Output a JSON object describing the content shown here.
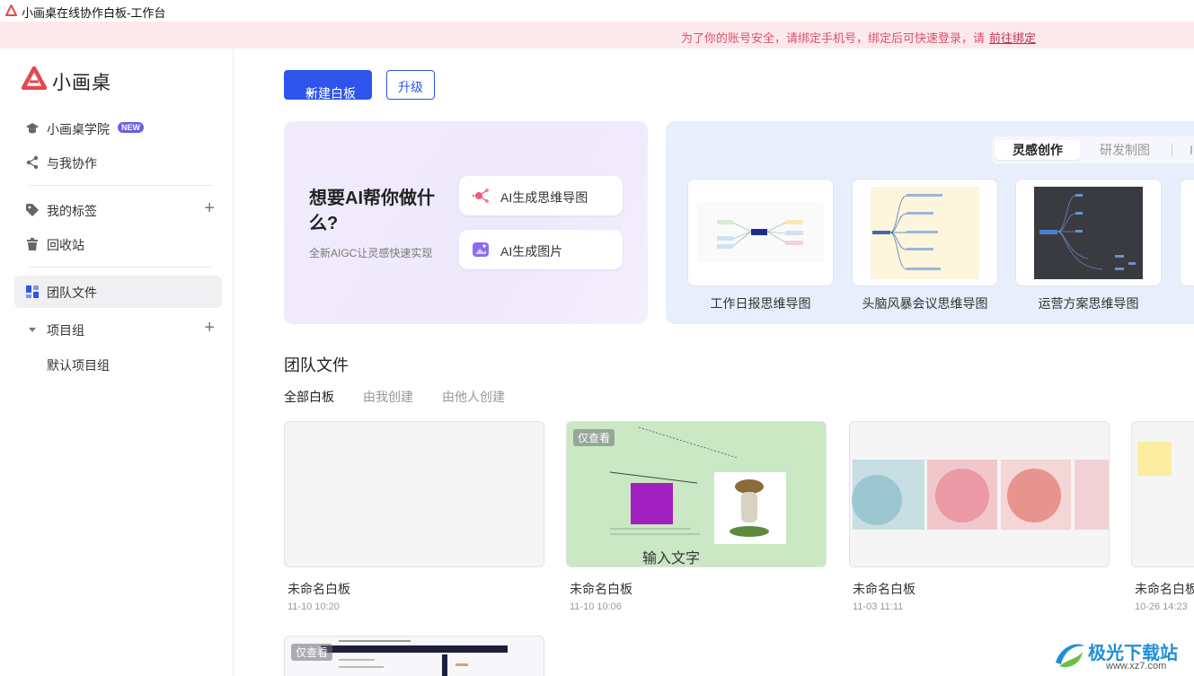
{
  "window": {
    "title": "小画桌在线协作白板-工作台"
  },
  "banner": {
    "message": "为了你的账号安全，请绑定手机号，绑定后可快速登录，请",
    "link": "前往绑定"
  },
  "brand": {
    "name": "小画桌",
    "color": "#e5484d"
  },
  "sidebar": {
    "academy": {
      "label": "小画桌学院",
      "badge": "NEW"
    },
    "collab": {
      "label": "与我协作"
    },
    "tags": {
      "label": "我的标签"
    },
    "trash": {
      "label": "回收站"
    },
    "team_files": {
      "label": "团队文件"
    },
    "project_group": {
      "label": "项目组"
    },
    "default_group": {
      "label": "默认项目组"
    }
  },
  "toolbar": {
    "new_board": "新建白板",
    "upgrade": "升级"
  },
  "ai_card": {
    "headline": "想要AI帮你做什么?",
    "subtitle": "全新AIGC让灵感快速实现",
    "mindmap_button": "AI生成思维导图",
    "image_button": "AI生成图片"
  },
  "templates": {
    "tabs": [
      "灵感创作",
      "研发制图",
      "I"
    ],
    "items": [
      {
        "label": "工作日报思维导图"
      },
      {
        "label": "头脑风暴会议思维导图"
      },
      {
        "label": "运营方案思维导图"
      }
    ]
  },
  "team": {
    "title": "团队文件",
    "filters": [
      "全部白板",
      "由我创建",
      "由他人创建"
    ],
    "files": [
      {
        "name": "未命名白板",
        "time": "11-10 10:20",
        "readonly": ""
      },
      {
        "name": "未命名白板",
        "time": "11-10 10:06",
        "readonly": "仅查看",
        "canvas_text": "输入文字"
      },
      {
        "name": "未命名白板",
        "time": "11-03 11:11",
        "readonly": ""
      },
      {
        "name": "未命名白板",
        "time": "10-26 14:23",
        "readonly": ""
      },
      {
        "name": "",
        "time": "",
        "readonly": "仅查看"
      }
    ]
  },
  "watermark": {
    "title": "极光下载站",
    "url": "www.xz7.com"
  },
  "colors": {
    "primary": "#2f54eb",
    "banner_bg": "#fde9ec",
    "banner_text": "#d9536a"
  }
}
